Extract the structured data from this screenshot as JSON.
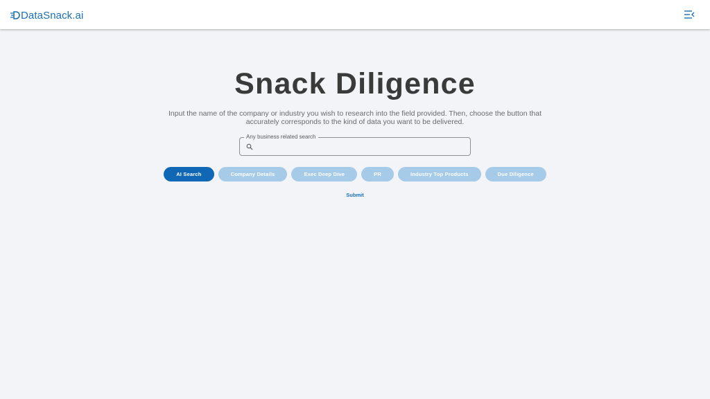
{
  "header": {
    "logo_text": "DataSnack.ai",
    "logo_icon": "speed-lines-d-icon",
    "menu_icon": "menu-collapse-icon"
  },
  "main": {
    "title": "Snack Diligence",
    "description": "Input the name of the company or industry you wish to research into the field provided. Then, choose the button that accurately corresponds to the kind of data you want to be delivered.",
    "search": {
      "label": "Any business related search",
      "value": "",
      "placeholder": "",
      "icon": "search-icon"
    },
    "options": [
      {
        "label": "AI Search",
        "selected": true
      },
      {
        "label": "Company Details",
        "selected": false
      },
      {
        "label": "Exec Deep Dive",
        "selected": false
      },
      {
        "label": "PR",
        "selected": false
      },
      {
        "label": "Industry Top Products",
        "selected": false
      },
      {
        "label": "Due Diligence",
        "selected": false
      }
    ],
    "submit_label": "Submit"
  },
  "colors": {
    "brand": "#1a6fb5",
    "chip_active": "#1067b6",
    "chip_inactive": "#a6cbe8",
    "background": "#f2f4f7",
    "title": "#3a3a3a"
  }
}
